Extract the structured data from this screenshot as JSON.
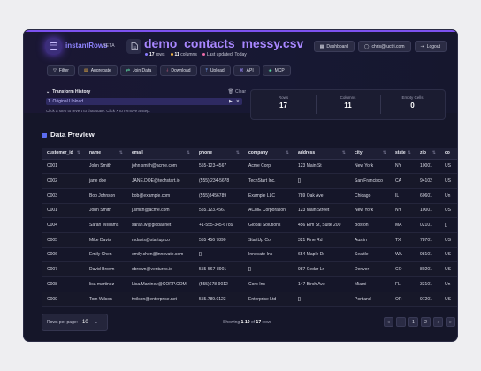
{
  "app": {
    "name": "instantRows",
    "badge": "BETA"
  },
  "file": {
    "title": "demo_contacts_messy.csv",
    "rows_count": "17",
    "rows_suffix": "rows",
    "cols_count": "11",
    "cols_suffix": "columns",
    "updated": "Last updated: Today"
  },
  "nav": {
    "dashboard": "Dashboard",
    "user_email": "chris@juctri.com",
    "logout": "Logout"
  },
  "toolbar": [
    "Filter",
    "Aggregate",
    "Join Data",
    "Download",
    "Upload",
    "API",
    "MCP"
  ],
  "transform_history": {
    "title": "Transform History",
    "clear": "Clear",
    "item": "1. Original Upload",
    "hint": "Click a step to revert to that state. Click × to remove a step."
  },
  "stats": [
    {
      "label": "Rows",
      "value": "17"
    },
    {
      "label": "Columns",
      "value": "11"
    },
    {
      "label": "Empty Cells",
      "value": "0"
    }
  ],
  "section_title": "Data Preview",
  "table": {
    "columns": [
      "customer_id",
      "name",
      "email",
      "phone",
      "company",
      "address",
      "city",
      "state",
      "zip",
      "co"
    ],
    "rows": [
      [
        "C001",
        "John Smith",
        "john.smith@acme.com",
        "555-123-4567",
        "Acme Corp",
        "123 Main St",
        "New York",
        "NY",
        "10001",
        "US"
      ],
      [
        "C002",
        "jane doe",
        "JANE.DOE@techstart.io",
        "(555) 234-5678",
        "TechStart Inc.",
        "[]",
        "San Francisco",
        "CA",
        "94102",
        "US"
      ],
      [
        "C003",
        "Bob Johnson",
        "bob@example.com",
        "(555)3456789",
        "Example LLC",
        "789 Oak Ave",
        "Chicago",
        "IL",
        "60601",
        "Un"
      ],
      [
        "C001",
        "John Smith",
        "j.smith@acme.com",
        "555.123.4567",
        "ACME Corporation",
        "123 Main Street",
        "New York",
        "NY",
        "10001",
        "US"
      ],
      [
        "C004",
        "Sarah Williams",
        "sarah.w@global.net",
        "+1-555-345-6789",
        "Global Solutions",
        "456 Elm St, Suite 200",
        "Boston",
        "MA",
        "02101",
        "[]"
      ],
      [
        "C005",
        "Mike Davis",
        "mdavis@startup.co",
        "555 456 7890",
        "StartUp Co",
        "321 Pine Rd",
        "Austin",
        "TX",
        "78701",
        "US"
      ],
      [
        "C006",
        "Emily Chen",
        "emily.chen@innovate.com",
        "[]",
        "Innovate Inc",
        "654 Maple Dr",
        "Seattle",
        "WA",
        "98101",
        "US"
      ],
      [
        "C007",
        "David Brown",
        "dbrown@ventures.io",
        "555-567-8901",
        "[]",
        "987 Cedar Ln",
        "Denver",
        "CO",
        "80201",
        "US"
      ],
      [
        "C008",
        "lisa martinez",
        "Lisa.Martinez@CORP.COM",
        "(555)678-9012",
        "Corp Inc",
        "147 Birch Ave",
        "Miami",
        "FL",
        "33101",
        "Un"
      ],
      [
        "C009",
        "Tom Wilson",
        "twilson@enterprise.net",
        "555.789.0123",
        "Enterprise Ltd",
        "[]",
        "Portland",
        "OR",
        "97201",
        "US"
      ]
    ]
  },
  "footer": {
    "rows_per_page_label": "Rows per page:",
    "rows_per_page_value": "10",
    "showing_prefix": "Showing",
    "showing_range": "1-10",
    "showing_of": "of",
    "showing_total": "17",
    "showing_suffix": "rows",
    "pages": [
      "«",
      "‹",
      "1",
      "2",
      "›",
      "»"
    ]
  },
  "colors": {
    "accent": "#7d52f0",
    "brand_text": "#8f84ff",
    "title": "#a887ff",
    "bg": "#151629"
  }
}
